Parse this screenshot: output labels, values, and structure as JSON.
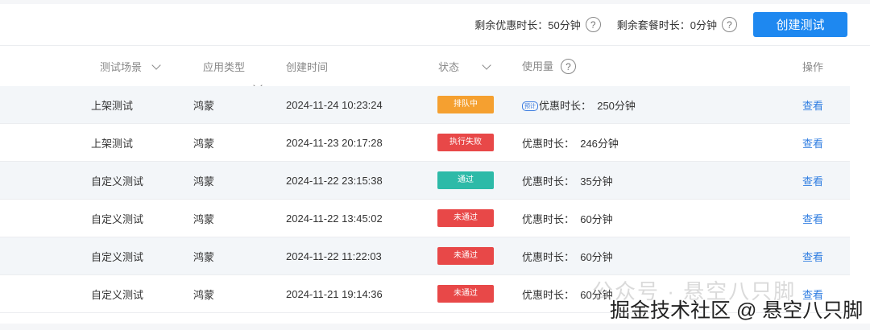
{
  "topbar": {
    "promo_quota": "剩余优惠时长：50分钟",
    "package_quota": "剩余套餐时长：0分钟",
    "create_button": "创建测试",
    "help": "?"
  },
  "columns": {
    "scene": "测试场景",
    "app_type": "应用类型",
    "created": "创建时间",
    "status": "状态",
    "usage": "使用量",
    "action": "操作"
  },
  "status_colors": {
    "排队中": "#f5a030",
    "执行失败": "#e84848",
    "通过": "#2dbaa8",
    "未通过": "#e84848"
  },
  "rows": [
    {
      "scene": "上架测试",
      "type": "鸿蒙",
      "time": "2024-11-24 10:23:24",
      "status": "排队中",
      "status_color": "#f5a030",
      "tag": "预计",
      "usage": "优惠时长：  250分钟",
      "action": "查看"
    },
    {
      "scene": "上架测试",
      "type": "鸿蒙",
      "time": "2024-11-23 20:17:28",
      "status": "执行失败",
      "status_color": "#e84848",
      "usage": "优惠时长：  246分钟",
      "action": "查看"
    },
    {
      "scene": "自定义测试",
      "type": "鸿蒙",
      "time": "2024-11-22 23:15:38",
      "status": "通过",
      "status_color": "#2dbaa8",
      "usage": "优惠时长：  35分钟",
      "action": "查看"
    },
    {
      "scene": "自定义测试",
      "type": "鸿蒙",
      "time": "2024-11-22 13:45:02",
      "status": "未通过",
      "status_color": "#e84848",
      "usage": "优惠时长：  60分钟",
      "action": "查看"
    },
    {
      "scene": "自定义测试",
      "type": "鸿蒙",
      "time": "2024-11-22 11:22:03",
      "status": "未通过",
      "status_color": "#e84848",
      "usage": "优惠时长：  60分钟",
      "action": "查看"
    },
    {
      "scene": "自定义测试",
      "type": "鸿蒙",
      "time": "2024-11-21 19:14:36",
      "status": "未通过",
      "status_color": "#e84848",
      "usage": "优惠时长：  60分钟",
      "action": "查看"
    }
  ],
  "watermark": {
    "wechat": "公众号 · 悬空八只脚",
    "juejin": "掘金技术社区 @ 悬空八只脚"
  }
}
